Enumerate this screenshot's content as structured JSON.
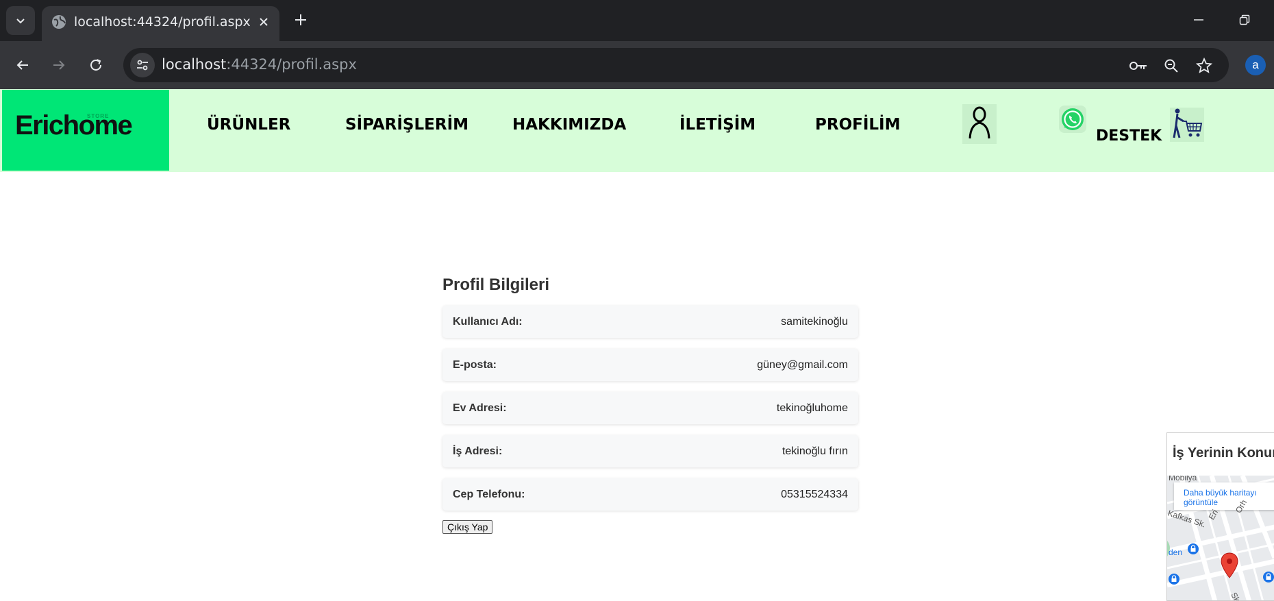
{
  "browser": {
    "tab_title": "localhost:44324/profil.aspx",
    "url_host": "localhost",
    "url_rest": ":44324/profil.aspx",
    "profile_initial": "a"
  },
  "header": {
    "logo": "Erichome",
    "logo_tag": "STORE",
    "nav": [
      "ÜRÜNLER",
      "SİPARİŞLERİM",
      "HAKKIMIZDA",
      "İLETİŞİM",
      "PROFİLİM"
    ],
    "support_label": "DESTEK",
    "accent_color": "#00e676",
    "header_bg": "#d7fdd9"
  },
  "profile": {
    "title": "Profil Bilgileri",
    "rows": [
      {
        "label": "Kullanıcı Adı:",
        "value": "samitekinoğlu"
      },
      {
        "label": "E-posta:",
        "value": "güney@gmail.com"
      },
      {
        "label": "Ev Adresi:",
        "value": "tekinoğluhome"
      },
      {
        "label": "İş Adresi:",
        "value": "tekinoğlu fırın"
      },
      {
        "label": "Cep Telefonu:",
        "value": "05315524334"
      }
    ],
    "logout_label": "Çıkış Yap"
  },
  "map": {
    "title": "İş Yerinin Konum",
    "link_text": "Daha büyük haritayı görüntüle",
    "labels": [
      "Mobilya",
      "Kafkas Sk.",
      "Eri",
      "Orh",
      "den",
      "Sk."
    ]
  }
}
